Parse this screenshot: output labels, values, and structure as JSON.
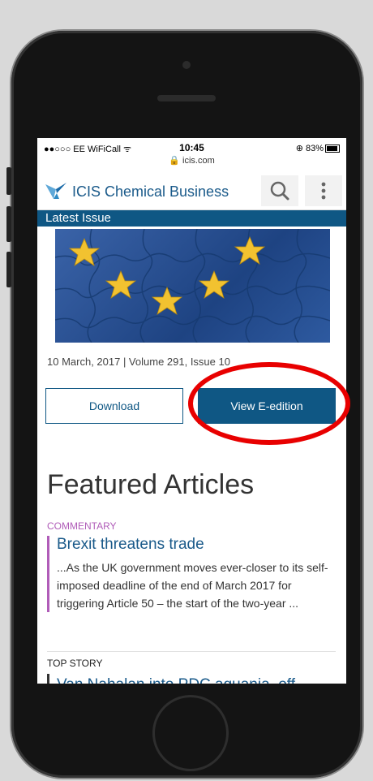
{
  "status_bar": {
    "carrier": "●●○○○ EE WiFiCall ᯤ",
    "time": "10:45",
    "url": "🔒 icis.com",
    "battery": "⊕ 83%"
  },
  "header": {
    "brand": "ICIS Chemical Business",
    "search_icon": "search-icon",
    "more_icon": "more-vertical-icon"
  },
  "latest_issue": {
    "label": "Latest Issue",
    "date_line": "10 March, 2017 | Volume 291, Issue 10",
    "download_label": "Download",
    "view_label": "View E-edition"
  },
  "featured": {
    "heading": "Featured Articles",
    "article": {
      "category": "COMMENTARY",
      "title": "Brexit threatens trade",
      "excerpt": "...As the UK government moves ever-closer to its self-imposed deadline of the end of March 2017 for triggering Article 50 – the start of the two-year ..."
    },
    "next_category": "TOP STORY",
    "next_title": "Van Nahalan into PDC aguania, off"
  },
  "colors": {
    "brand_blue": "#0f5784",
    "category_purple": "#b05cb8",
    "annotation_red": "#e80000"
  }
}
